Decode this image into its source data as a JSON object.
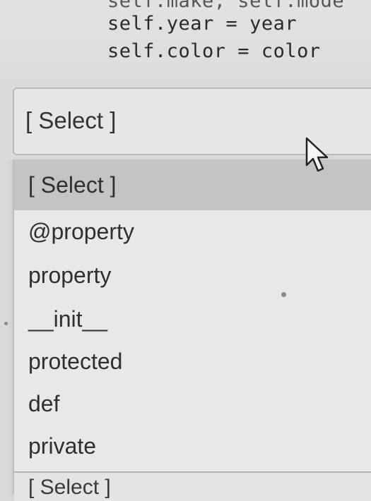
{
  "code": {
    "lines": [
      "self.make, self.mode",
      "self.year = year",
      "self.color = color"
    ]
  },
  "select": {
    "value": "[ Select ]"
  },
  "dropdown": {
    "options": [
      "[ Select ]",
      "@property",
      "property",
      "__init__",
      "protected",
      "def",
      "private"
    ],
    "selected_index": 0
  },
  "next_select": {
    "value": "[ Select ]"
  },
  "icons": {
    "cursor": "mouse-pointer-icon"
  }
}
